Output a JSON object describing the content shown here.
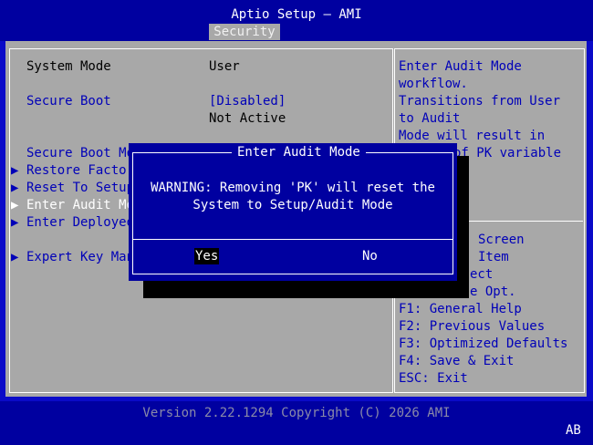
{
  "header": {
    "title": "Aptio Setup – AMI",
    "active_tab": "Security"
  },
  "left": {
    "system_mode_label": "System Mode",
    "system_mode_value": "User",
    "secure_boot_label": "Secure Boot",
    "secure_boot_value": "[Disabled]",
    "secure_boot_status": "Not Active",
    "secure_boot_mode_label": "Secure Boot Mo",
    "items": [
      {
        "arrow": "▶",
        "label": "Restore Factor"
      },
      {
        "arrow": "▶",
        "label": "Reset To Setup"
      },
      {
        "arrow": "▶",
        "label": "Enter Audit Mo"
      },
      {
        "arrow": "▶",
        "label": "Enter Deployed"
      },
      {
        "arrow": "▶",
        "label": "Expert Key Man"
      }
    ]
  },
  "help": {
    "lines": [
      "Enter Audit Mode",
      "workflow.",
      "Transitions from User",
      "to Audit",
      "Mode will result in",
      "of PK variable"
    ],
    "keys": [
      "Screen",
      "Item",
      "ect",
      "e Opt.",
      "F1: General Help",
      "F2: Previous Values",
      "F3: Optimized Defaults",
      "F4: Save & Exit",
      "ESC: Exit"
    ]
  },
  "dialog": {
    "title": "Enter Audit Mode",
    "message_line1": "WARNING: Removing 'PK' will reset the",
    "message_line2": "System to Setup/Audit Mode",
    "yes_label": "Yes",
    "no_label": "No"
  },
  "footer": {
    "version": "Version 2.22.1294 Copyright (C) 2026 AMI",
    "indicator": "AB"
  }
}
